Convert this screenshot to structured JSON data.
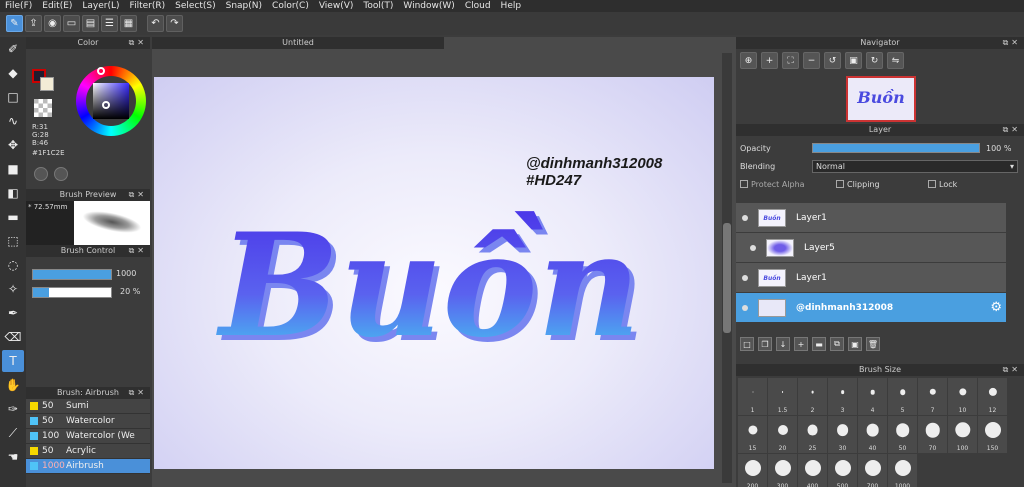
{
  "menu": [
    "File(F)",
    "Edit(E)",
    "Layer(L)",
    "Filter(R)",
    "Select(S)",
    "Snap(N)",
    "Color(C)",
    "View(V)",
    "Tool(T)",
    "Window(W)",
    "Cloud",
    "Help"
  ],
  "color_panel": {
    "title": "Color",
    "r": "R:31",
    "g": "G:28",
    "b": "B:46",
    "hex": "#1F1C2E",
    "fg_color": "#1f1c2e",
    "bg_color": "#f3ecd6"
  },
  "brush_preview": {
    "title": "Brush Preview",
    "size": "* 72.57mm"
  },
  "brush_control": {
    "title": "Brush Control",
    "size_value": "1000",
    "opacity_value": "20 %",
    "size_fraction": 1.0,
    "opacity_fraction": 0.2
  },
  "brush_list": {
    "title": "Brush: Airbrush",
    "items": [
      {
        "num": "50",
        "name": "Sumi",
        "color": "#f5d800"
      },
      {
        "num": "50",
        "name": "Watercolor",
        "color": "#4fc3f7"
      },
      {
        "num": "100",
        "name": "Watercolor (We",
        "color": "#4fc3f7"
      },
      {
        "num": "50",
        "name": "Acrylic",
        "color": "#f5d800"
      },
      {
        "num": "1000",
        "name": "Airbrush",
        "color": "#4fc3f7"
      }
    ]
  },
  "canvas": {
    "tab": "Untitled",
    "title_text": "Buồn",
    "watermark_line1": "@dinhmanh312008",
    "watermark_line2": "#HD247"
  },
  "navigator": {
    "title": "Navigator",
    "thumb_text": "Buồn"
  },
  "layer": {
    "title": "Layer",
    "opacity_label": "Opacity",
    "opacity_value": "100 %",
    "blending_label": "Blending",
    "blending_value": "Normal",
    "protect_alpha": "Protect Alpha",
    "clipping": "Clipping",
    "lock": "Lock",
    "layers": [
      {
        "name": "Layer1",
        "thumb": "Buồn"
      },
      {
        "name": "Layer5",
        "thumb": ""
      },
      {
        "name": "Layer1",
        "thumb": "Buồn"
      },
      {
        "name": "@dinhmanh312008",
        "thumb": ""
      }
    ]
  },
  "brush_size": {
    "title": "Brush Size",
    "sizes": [
      "1",
      "1.5",
      "2",
      "3",
      "4",
      "5",
      "7",
      "10",
      "12",
      "15",
      "20",
      "25",
      "30",
      "40",
      "50",
      "70",
      "100",
      "150",
      "200",
      "300",
      "400",
      "500",
      "700",
      "1000"
    ]
  }
}
